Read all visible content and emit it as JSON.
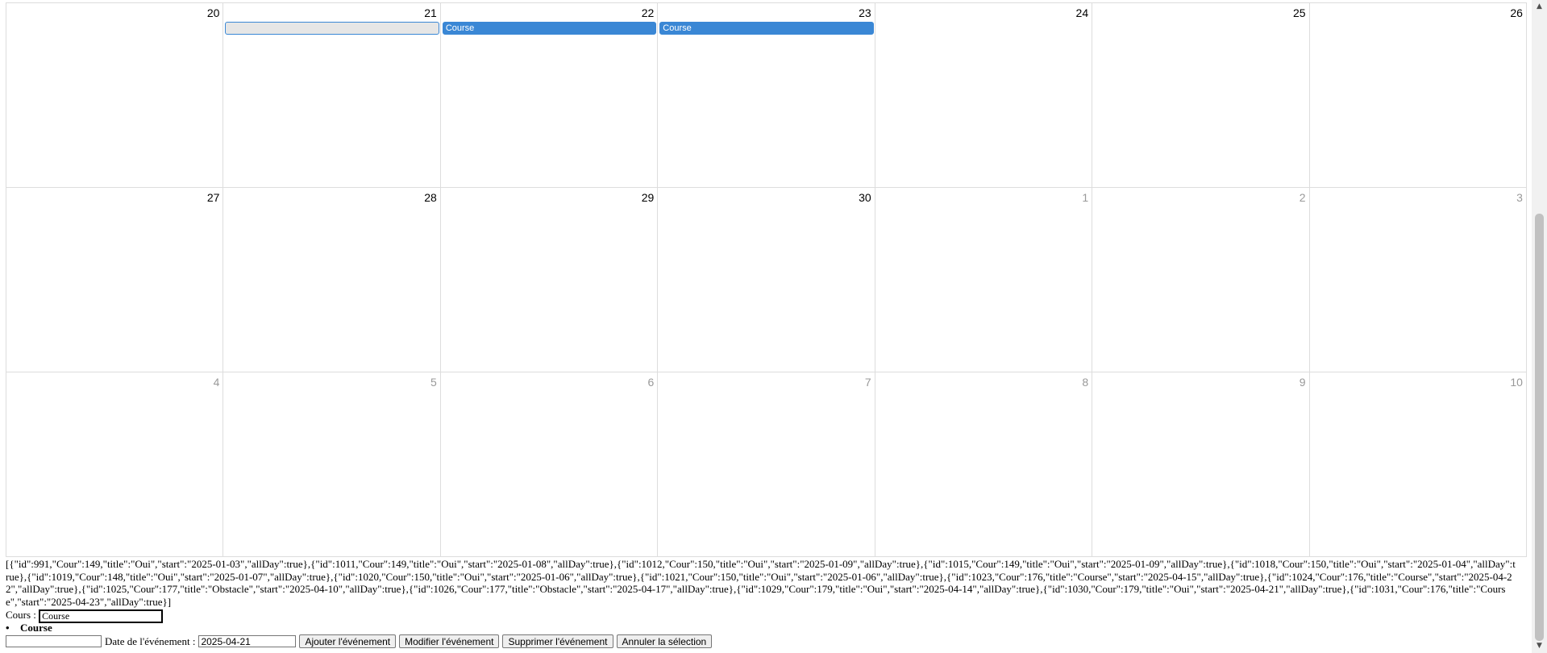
{
  "calendar": {
    "weeks": [
      {
        "days": [
          {
            "label": "20",
            "other": false
          },
          {
            "label": "21",
            "other": false
          },
          {
            "label": "22",
            "other": false
          },
          {
            "label": "23",
            "other": false
          },
          {
            "label": "24",
            "other": false
          },
          {
            "label": "25",
            "other": false
          },
          {
            "label": "26",
            "other": false
          }
        ],
        "events": [
          {
            "title": "",
            "day": 1,
            "selected": true
          },
          {
            "title": "Course",
            "day": 2,
            "selected": false
          },
          {
            "title": "Course",
            "day": 3,
            "selected": false
          }
        ]
      },
      {
        "days": [
          {
            "label": "27",
            "other": false
          },
          {
            "label": "28",
            "other": false
          },
          {
            "label": "29",
            "other": false
          },
          {
            "label": "30",
            "other": false
          },
          {
            "label": "1",
            "other": true
          },
          {
            "label": "2",
            "other": true
          },
          {
            "label": "3",
            "other": true
          }
        ],
        "events": []
      },
      {
        "days": [
          {
            "label": "4",
            "other": true
          },
          {
            "label": "5",
            "other": true
          },
          {
            "label": "6",
            "other": true
          },
          {
            "label": "7",
            "other": true
          },
          {
            "label": "8",
            "other": true
          },
          {
            "label": "9",
            "other": true
          },
          {
            "label": "10",
            "other": true
          }
        ],
        "events": []
      }
    ]
  },
  "json_dump": "[{\"id\":991,\"Cour\":149,\"title\":\"Oui\",\"start\":\"2025-01-03\",\"allDay\":true},{\"id\":1011,\"Cour\":149,\"title\":\"Oui\",\"start\":\"2025-01-08\",\"allDay\":true},{\"id\":1012,\"Cour\":150,\"title\":\"Oui\",\"start\":\"2025-01-09\",\"allDay\":true},{\"id\":1015,\"Cour\":149,\"title\":\"Oui\",\"start\":\"2025-01-09\",\"allDay\":true},{\"id\":1018,\"Cour\":150,\"title\":\"Oui\",\"start\":\"2025-01-04\",\"allDay\":true},{\"id\":1019,\"Cour\":148,\"title\":\"Oui\",\"start\":\"2025-01-07\",\"allDay\":true},{\"id\":1020,\"Cour\":150,\"title\":\"Oui\",\"start\":\"2025-01-06\",\"allDay\":true},{\"id\":1021,\"Cour\":150,\"title\":\"Oui\",\"start\":\"2025-01-06\",\"allDay\":true},{\"id\":1023,\"Cour\":176,\"title\":\"Course\",\"start\":\"2025-04-15\",\"allDay\":true},{\"id\":1024,\"Cour\":176,\"title\":\"Course\",\"start\":\"2025-04-22\",\"allDay\":true},{\"id\":1025,\"Cour\":177,\"title\":\"Obstacle\",\"start\":\"2025-04-10\",\"allDay\":true},{\"id\":1026,\"Cour\":177,\"title\":\"Obstacle\",\"start\":\"2025-04-17\",\"allDay\":true},{\"id\":1029,\"Cour\":179,\"title\":\"Oui\",\"start\":\"2025-04-14\",\"allDay\":true},{\"id\":1030,\"Cour\":179,\"title\":\"Oui\",\"start\":\"2025-04-21\",\"allDay\":true},{\"id\":1031,\"Cour\":176,\"title\":\"Course\",\"start\":\"2025-04-23\",\"allDay\":true}]",
  "form": {
    "cours_label": "Cours :",
    "cours_value": "Course",
    "suggestions": [
      "Course"
    ],
    "title_value": "",
    "date_label": "Date de l'événement :",
    "date_value": "2025-04-21",
    "add_button": "Ajouter l'événement",
    "edit_button": "Modifier l'événement",
    "delete_button": "Supprimer l'événement",
    "cancel_button": "Annuler la sélection"
  },
  "scrollbar": {
    "up_icon": "▲",
    "down_icon": "▼"
  },
  "colors": {
    "event": "#3a87d5",
    "grid": "#dddddd"
  }
}
